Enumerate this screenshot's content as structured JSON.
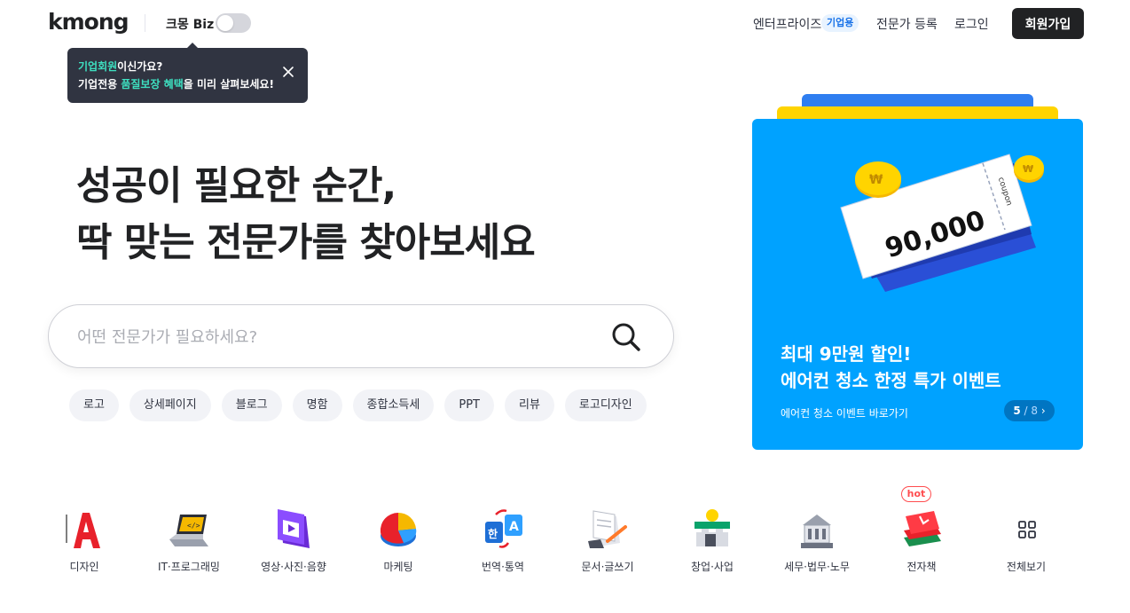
{
  "header": {
    "logo": "kmong",
    "biz_label": "크몽 Biz",
    "biz_toggle_on": false,
    "nav_enterprise": "엔터프라이즈",
    "nav_enterprise_badge": "기업용",
    "nav_expert": "전문가 등록",
    "nav_login": "로그인",
    "signup": "회원가입"
  },
  "tooltip": {
    "line1_highlight": "기업회원",
    "line1_rest": "이신가요?",
    "line2_pre": "기업전용 ",
    "line2_highlight": "품질보장 혜택",
    "line2_rest": "을 미리 살펴보세요!",
    "close_icon": "close-icon"
  },
  "hero": {
    "headline_line1": "성공이 필요한 순간,",
    "headline_line2": "딱 맞는 전문가를 찾아보세요"
  },
  "search": {
    "placeholder": "어떤 전문가가 필요하세요?",
    "icon": "search-icon"
  },
  "chips": [
    "로고",
    "상세페이지",
    "블로그",
    "명함",
    "종합소득세",
    "PPT",
    "리뷰",
    "로고디자인"
  ],
  "banner": {
    "coupon_amount": "90,000",
    "coupon_word": "coupon",
    "title_line1": "최대 9만원 할인!",
    "title_line2": "에어컨 청소 한정 특가 이벤트",
    "subtitle": "에어컨 청소 이벤트 바로가기",
    "page_current": "5",
    "page_total": "/ 8",
    "colors": {
      "bg": "#00a2ff",
      "back1": "#2f7ef0",
      "back2": "#ffd400"
    }
  },
  "categories": [
    {
      "label": "디자인",
      "icon": "design-icon"
    },
    {
      "label": "IT·프로그래밍",
      "icon": "laptop-icon"
    },
    {
      "label": "영상·사진·음향",
      "icon": "video-icon"
    },
    {
      "label": "마케팅",
      "icon": "pie-chart-icon"
    },
    {
      "label": "번역·통역",
      "icon": "translate-icon"
    },
    {
      "label": "문서·글쓰기",
      "icon": "document-pen-icon"
    },
    {
      "label": "창업·사업",
      "icon": "store-icon"
    },
    {
      "label": "세무·법무·노무",
      "icon": "building-icon"
    },
    {
      "label": "전자책",
      "icon": "ebook-icon",
      "badge": "hot"
    },
    {
      "label": "전체보기",
      "icon": "grid-icon"
    }
  ]
}
